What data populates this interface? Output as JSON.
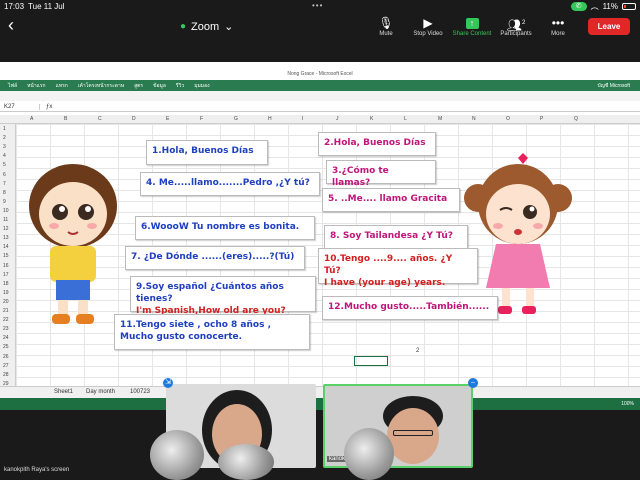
{
  "status": {
    "time": "17:03",
    "date": "Tue 11 Jul",
    "battery": "11%"
  },
  "zoom": {
    "title": "Zoom",
    "controls": [
      {
        "label": "Mute",
        "icon": "microphone-icon"
      },
      {
        "label": "Stop Video",
        "icon": "video-camera-icon"
      },
      {
        "label": "Share Content",
        "icon": "share-screen-icon"
      },
      {
        "label": "Participants",
        "icon": "participants-icon",
        "count": "2"
      },
      {
        "label": "More",
        "icon": "more-icon"
      }
    ],
    "leave": "Leave"
  },
  "excel": {
    "window_title": "Nong Grace - Microsoft Excel",
    "name_box": "K27",
    "menu": [
      "ไฟล์",
      "หน้าแรก",
      "แทรก",
      "เค้าโครงหน้ากระดาษ",
      "สูตร",
      "ข้อมูล",
      "รีวิว",
      "มุมมอง"
    ],
    "account": "บัญชี Microsoft",
    "columns": [
      "A",
      "B",
      "C",
      "D",
      "E",
      "F",
      "G",
      "H",
      "I",
      "J",
      "K",
      "L",
      "M",
      "N",
      "O",
      "P",
      "Q"
    ],
    "rows": [
      "1",
      "2",
      "3",
      "4",
      "5",
      "6",
      "7",
      "8",
      "9",
      "10",
      "11",
      "12",
      "13",
      "14",
      "15",
      "16",
      "17",
      "18",
      "19",
      "20",
      "21",
      "22",
      "23",
      "24",
      "25",
      "26",
      "27",
      "28",
      "29"
    ],
    "cell_value": "2",
    "sheets": [
      "Sheet1",
      "Day month",
      "100723"
    ],
    "zoom_pct": "100%"
  },
  "cards_left": [
    {
      "id": "c1",
      "lines": [
        "1.Hola, Buenos Días"
      ],
      "color": "blue"
    },
    {
      "id": "c4",
      "lines": [
        "4. Me.....llamo.......Pedro ,¿Y tú?"
      ],
      "color": "blue"
    },
    {
      "id": "c6",
      "lines": [
        "6.WoooW Tu nombre es bonita."
      ],
      "color": "blue"
    },
    {
      "id": "c7",
      "lines": [
        "7. ¿De Dónde ......(eres).....?(Tú)"
      ],
      "color": "blue"
    },
    {
      "id": "c9",
      "lines": [
        "9.Soy español ¿Cuántos años tienes?",
        "I'm Spanish,How old are you?"
      ],
      "color": "magenta"
    },
    {
      "id": "c11",
      "lines": [
        "11.Tengo  siete , ocho 8 años ,",
        "Mucho gusto conocerte."
      ],
      "color": "blue"
    }
  ],
  "cards_right": [
    {
      "id": "c2",
      "lines": [
        "2.Hola, Buenos Días"
      ],
      "color": "magenta"
    },
    {
      "id": "c3",
      "lines": [
        "3.¿Cómo te llamas?"
      ],
      "color": "magenta"
    },
    {
      "id": "c5",
      "lines": [
        "5.  ..Me.... llamo Gracita"
      ],
      "color": "magenta"
    },
    {
      "id": "c8",
      "lines": [
        "8. Soy Tailandesa ¿Y Tú?"
      ],
      "color": "magenta"
    },
    {
      "id": "c10",
      "lines": [
        "10.Tengo ....9.... años. ¿Y Tú?",
        "I have (your age) years."
      ],
      "color": "red"
    },
    {
      "id": "c12",
      "lines": [
        "12.Mucho gusto.....También......"
      ],
      "color": "magenta"
    }
  ],
  "video": {
    "participant2_label": "kanok",
    "screen_label": "kanokpith Raya's screen"
  }
}
